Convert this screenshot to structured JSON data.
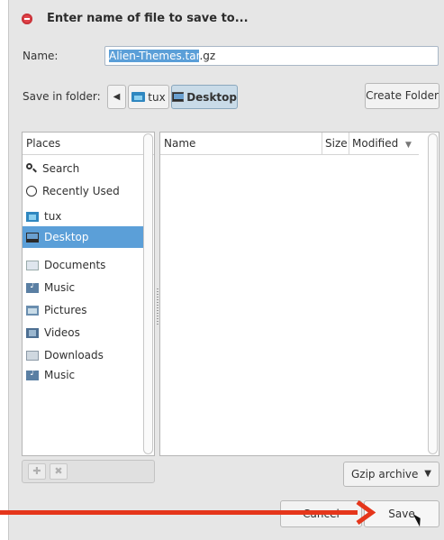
{
  "window": {
    "title": "Enter name of file to save to..."
  },
  "name_field": {
    "label": "Name:",
    "selected_part": "Alien-Themes.tar",
    "rest": ".gz"
  },
  "folder": {
    "label": "Save in folder:",
    "crumbs": [
      "tux",
      "Desktop"
    ]
  },
  "create_folder_label": "Create Folder",
  "places": {
    "header": "Places",
    "items": [
      {
        "label": "Search",
        "icon": "search-icon"
      },
      {
        "label": "Recently Used",
        "icon": "recent-icon"
      },
      {
        "label": "tux",
        "icon": "home-folder-icon"
      },
      {
        "label": "Desktop",
        "icon": "desktop-icon",
        "selected": true
      },
      {
        "label": "Documents",
        "icon": "documents-folder-icon"
      },
      {
        "label": "Music",
        "icon": "music-folder-icon"
      },
      {
        "label": "Pictures",
        "icon": "pictures-folder-icon"
      },
      {
        "label": "Videos",
        "icon": "videos-folder-icon"
      },
      {
        "label": "Downloads",
        "icon": "downloads-folder-icon"
      },
      {
        "label": "Music",
        "icon": "music-folder-icon"
      }
    ]
  },
  "file_list": {
    "columns": {
      "name": "Name",
      "size": "Size",
      "modified": "Modified"
    }
  },
  "filter": {
    "selected": "Gzip archive"
  },
  "buttons": {
    "cancel": "Cancel",
    "save": "Save"
  },
  "colors": {
    "selection": "#5b9fd8",
    "annotation_arrow": "#e5361b",
    "close": "#e2434a"
  }
}
